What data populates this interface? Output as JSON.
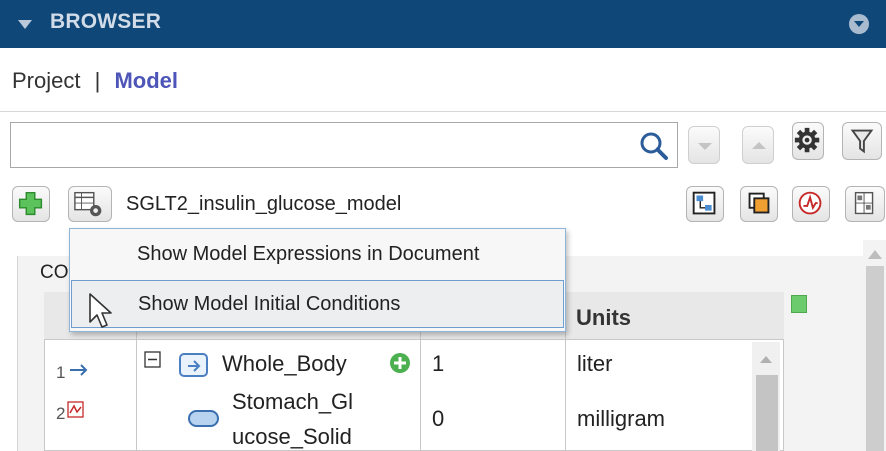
{
  "panel": {
    "title": "BROWSER"
  },
  "view_toggle": {
    "project": "Project",
    "separator": "|",
    "model": "Model"
  },
  "search": {
    "value": "",
    "placeholder": ""
  },
  "model": {
    "name": "SGLT2_insulin_glucose_model"
  },
  "context_menu": {
    "items": [
      {
        "label": "Show Model Expressions in Document"
      },
      {
        "label": "Show Model Initial Conditions"
      }
    ]
  },
  "components": {
    "label": "CO",
    "columns": {
      "units": "Units"
    },
    "rows": [
      {
        "num": "1",
        "name": "Whole_Body",
        "value": "1",
        "units": "liter"
      },
      {
        "num": "2",
        "name_line1": "Stomach_Gl",
        "name_line2": "ucose_Solid",
        "value": "0",
        "units": "milligram"
      }
    ]
  },
  "icons": {
    "collapse": "triangle-down-icon",
    "search": "magnifier-icon",
    "add": "green-plus-icon",
    "settings": "gear-icon",
    "filter": "funnel-icon",
    "status_color": "#6ccb6c"
  }
}
